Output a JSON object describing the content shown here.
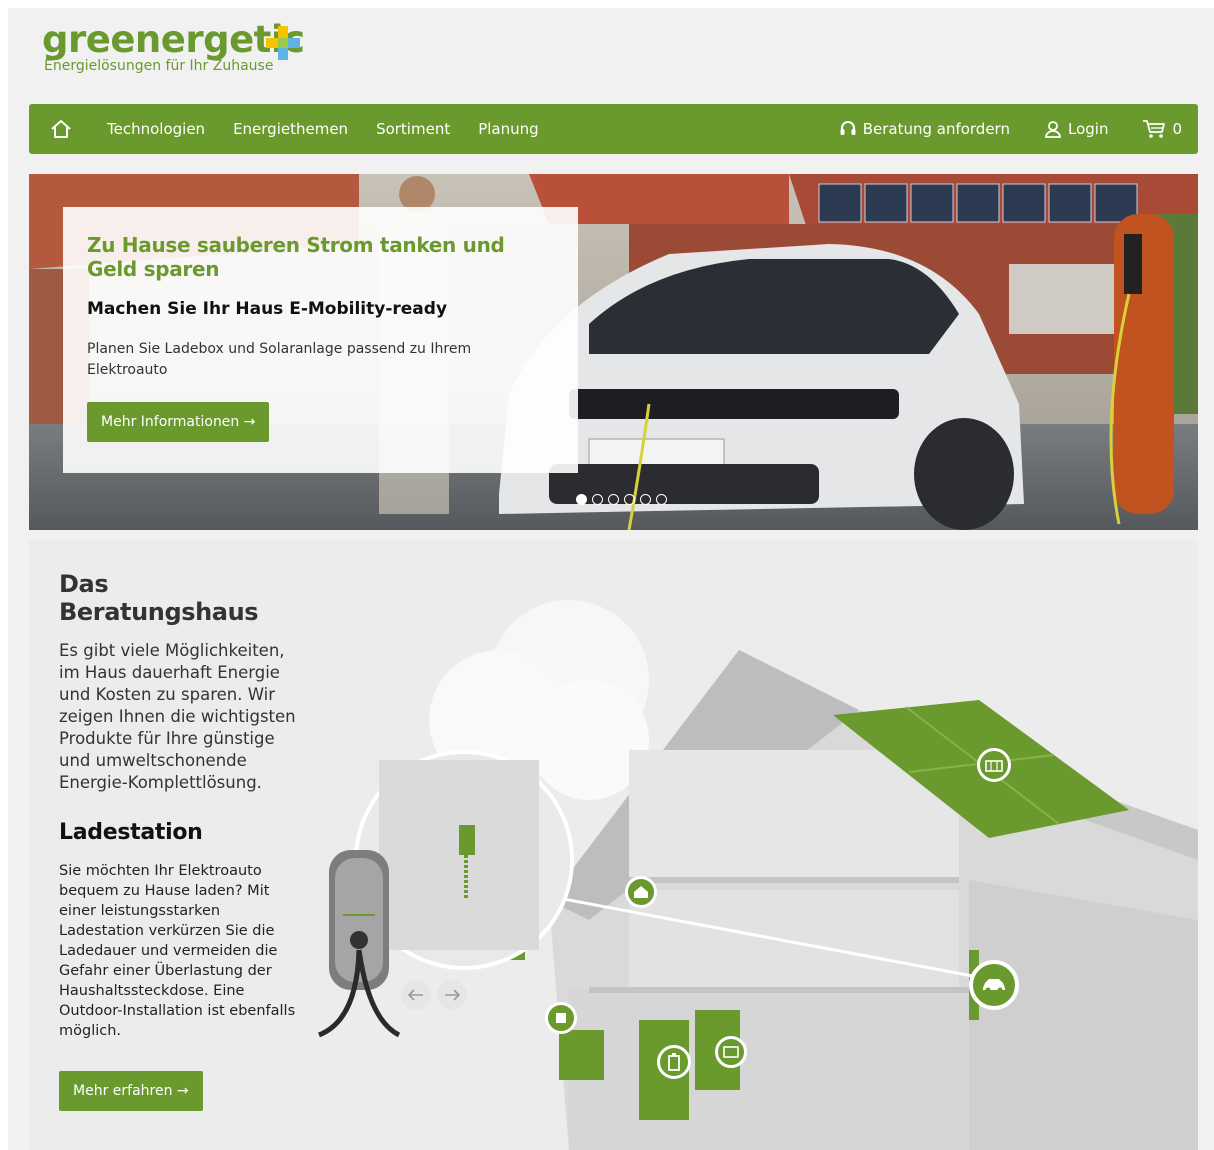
{
  "logo": {
    "word": "greenergetic",
    "tagline": "Energielösungen für Ihr Zuhause"
  },
  "nav": {
    "items": [
      "Technologien",
      "Energiethemen",
      "Sortiment",
      "Planung"
    ],
    "consult": "Beratung anfordern",
    "login": "Login",
    "cart_count": "0"
  },
  "hero": {
    "title": "Zu Hause sauberen Strom tanken und Geld sparen",
    "subtitle": "Machen Sie Ihr Haus E-Mobility-ready",
    "text": "Planen Sie Ladebox und Solaranlage passend zu Ihrem Elektroauto",
    "button": "Mehr Informationen →",
    "slides": 6,
    "active_slide": 1
  },
  "section": {
    "title": "Das Beratungshaus",
    "intro": "Es gibt viele Möglichkeiten, im Haus dauerhaft Energie und Kosten zu sparen. Wir zeigen Ihnen die wichtigsten Produkte für Ihre günstige und umweltschonende Energie-Komplettlösung.",
    "subtitle": "Ladestation",
    "text": "Sie möchten Ihr Elektroauto bequem zu Hause laden? Mit einer leistungsstarken Ladestation verkürzen Sie die Ladedauer und vermeiden die Gefahr einer Überlastung der Haushaltssteckdose. Eine Outdoor-Installation ist ebenfalls möglich.",
    "button": "Mehr erfahren →"
  },
  "colors": {
    "brand_green": "#6a9a2d",
    "accent_yellow": "#f5c400",
    "accent_blue": "#5fb4e4"
  },
  "icons": [
    "home-icon",
    "headset-icon",
    "user-icon",
    "cart-icon",
    "arrow-left-icon",
    "arrow-right-icon",
    "solar-panel-icon",
    "house-icon",
    "car-icon",
    "heat-pump-icon",
    "battery-icon",
    "boiler-icon"
  ]
}
